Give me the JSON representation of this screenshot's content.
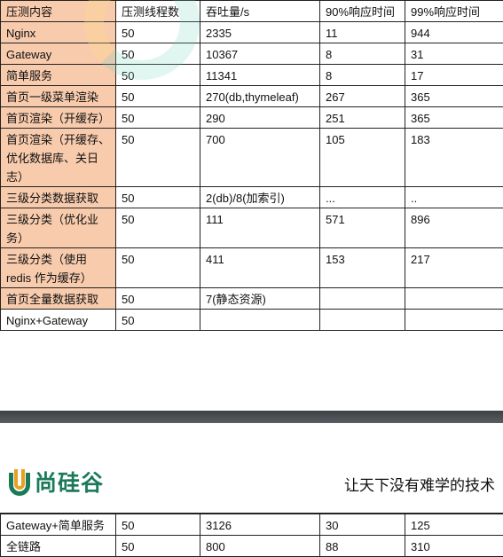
{
  "table": {
    "headers": [
      "压测内容",
      "压测线程数",
      "吞吐量/s",
      "90%响应时间",
      "99%响应时间"
    ],
    "rows": [
      [
        "Nginx",
        "50",
        "2335",
        "11",
        "944"
      ],
      [
        "Gateway",
        "50",
        "10367",
        "8",
        "31"
      ],
      [
        "简单服务",
        "50",
        "11341",
        "8",
        "17"
      ],
      [
        "首页一级菜单渲染",
        "50",
        "270(db,thymeleaf)",
        "267",
        "365"
      ],
      [
        "首页渲染（开缓存）",
        "50",
        "290",
        "251",
        "365"
      ],
      [
        "首页渲染（开缓存、优化数据库、关日志）",
        "50",
        "700",
        "105",
        "183"
      ],
      [
        "三级分类数据获取",
        "50",
        "2(db)/8(加索引)",
        "...",
        ".."
      ],
      [
        "三级分类（优化业务）",
        "50",
        "111",
        "571",
        "896"
      ],
      [
        "三级分类（使用redis 作为缓存）",
        "50",
        "411",
        "153",
        "217"
      ],
      [
        "首页全量数据获取",
        "50",
        "7(静态资源)",
        "",
        ""
      ],
      [
        "Nginx+Gateway",
        "50",
        "",
        "",
        ""
      ]
    ],
    "rows_page2": [
      [
        "Gateway+简单服务",
        "50",
        "3126",
        "30",
        "125"
      ],
      [
        "全链路",
        "50",
        "800",
        "88",
        "310"
      ]
    ]
  },
  "footer": {
    "logo_text": "尚硅谷",
    "slogan": "让天下没有难学的技术"
  },
  "colors": {
    "highlight": "#f8cbad",
    "brand": "#1a7a5a",
    "logo_accent": "#e8a020"
  }
}
